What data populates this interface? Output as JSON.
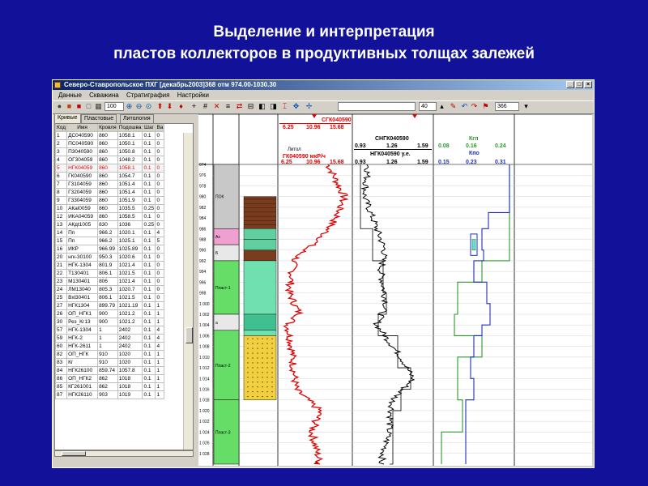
{
  "slide": {
    "title_line1": "Выделение  и интерпретация",
    "title_line2": "пластов коллекторов в продуктивных толщах залежей"
  },
  "window": {
    "title": "Северо-Ставропольское ПХГ [декабрь2003]368  отм  974.00-1030.30",
    "controls": [
      "_",
      "□",
      "×"
    ]
  },
  "menu": [
    "Данные",
    "Скважина",
    "Стратиграфия",
    "Настройки"
  ],
  "toolbar": {
    "zoom_value": "100",
    "field_value": "40",
    "select_value": "366"
  },
  "left_tabs": [
    "Кривые",
    "Пластовые",
    "Литология"
  ],
  "table": {
    "headers": [
      "Код",
      "Имя",
      "Кровля",
      "Подошва",
      "Шаг",
      "Ва"
    ],
    "rows": [
      [
        "1",
        "ДС040590",
        "860",
        "1058.1",
        "0.1",
        "0"
      ],
      [
        "2",
        "ПС040590",
        "860",
        "1050.1",
        "0.1",
        "0"
      ],
      [
        "3",
        "П3040590",
        "860",
        "1050.8",
        "0.1",
        "0"
      ],
      [
        "4",
        "ОГ304059",
        "860",
        "1048.2",
        "0.1",
        "0"
      ],
      [
        "5",
        "НГК04059",
        "860",
        "1058.1",
        "0.1",
        "0"
      ],
      [
        "6",
        "ГК040590",
        "860",
        "1054.7",
        "0.1",
        "0"
      ],
      [
        "7",
        "Г3104059",
        "860",
        "1051.4",
        "0.1",
        "0"
      ],
      [
        "8",
        "Г3204059",
        "860",
        "1051.4",
        "0.1",
        "0"
      ],
      [
        "9",
        "Г3304059",
        "860",
        "1051.9",
        "0.1",
        "0"
      ],
      [
        "10",
        "АКаl0059",
        "860",
        "1035.5",
        "0.25",
        "0"
      ],
      [
        "12",
        "ИКА04059",
        "860",
        "1058.5",
        "0.1",
        "0"
      ],
      [
        "13",
        "АКдt1005",
        "830",
        "1036",
        "0.25",
        "0"
      ],
      [
        "14",
        "Пп",
        "966.2",
        "1020.1",
        "0.1",
        "4"
      ],
      [
        "15",
        "Пп",
        "966.2",
        "1025.1",
        "0.1",
        "5"
      ],
      [
        "16",
        "ИКР",
        "966.99",
        "1025.89",
        "0.1",
        "0"
      ],
      [
        "20",
        "нгк-30100",
        "950.3",
        "1020.6",
        "0.1",
        "0"
      ],
      [
        "21",
        "НГК-1304",
        "801.9",
        "1021.4",
        "0.1",
        "0"
      ],
      [
        "22",
        "Т130401",
        "806.1",
        "1021.5",
        "0.1",
        "0"
      ],
      [
        "23",
        "М130401",
        "806",
        "1021.4",
        "0.1",
        "0"
      ],
      [
        "24",
        "ЛМ13040",
        "805.3",
        "1020.7",
        "0.1",
        "0"
      ],
      [
        "25",
        "Вхl30401",
        "806.1",
        "1021.5",
        "0.1",
        "0"
      ],
      [
        "27",
        "НГК1304",
        "899.79",
        "1021.19",
        "0.1",
        "1"
      ],
      [
        "26",
        "ОП_НГК1",
        "900",
        "1021.2",
        "0.1",
        "1"
      ],
      [
        "30",
        "Рез_Кг13",
        "900",
        "1021.2",
        "0.1",
        "1"
      ],
      [
        "57",
        "НГК-1304",
        "1",
        "2402",
        "0.1",
        "4"
      ],
      [
        "59",
        "НГК-2",
        "1",
        "2402",
        "0.1",
        "4"
      ],
      [
        "60",
        "НГК-2611",
        "1",
        "2402",
        "0.1",
        "4"
      ],
      [
        "82",
        "ОП_НГК",
        "910",
        "1020",
        "0.1",
        "1"
      ],
      [
        "83",
        "Кг",
        "910",
        "1020",
        "0.1",
        "1"
      ],
      [
        "84",
        "НГК26100",
        "859.74",
        "1057.8",
        "0.1",
        "1"
      ],
      [
        "86",
        "ОП_НГК2",
        "862",
        "1018",
        "0.1",
        "1"
      ],
      [
        "85",
        "КГ261001",
        "862",
        "1018",
        "0.1",
        "1"
      ],
      [
        "87",
        "НГК26110",
        "903",
        "1019",
        "0.1",
        "1"
      ]
    ],
    "selected_row": 4
  },
  "plot": {
    "lithology_header": "Литол",
    "gk_header": "ГК040590 мкР/ч",
    "gk_scale": [
      "6.25",
      "10.96",
      "15.68"
    ],
    "sgk_header": "СГК040590",
    "sgk_scale": [
      "6.25",
      "10.96",
      "15.68"
    ],
    "sngk_header": "СНГК040590",
    "sngk_scale": [
      "0.93",
      "1.26",
      "1.59"
    ],
    "ngk_header": "НГК040590 у.е.",
    "ngk_scale": [
      "0.93",
      "1.26",
      "1.59"
    ],
    "kgp_header": "Кгп",
    "kgp_scale": [
      "0.08",
      "0.16",
      "0.24"
    ],
    "kpo_header": "Кпо",
    "kpo_scale": [
      "0.15",
      "0.23",
      "0.31"
    ],
    "depth_labels": [
      "974",
      "976",
      "978",
      "980",
      "982",
      "984",
      "986",
      "988",
      "990",
      "992",
      "994",
      "996",
      "998",
      "1 000",
      "1 002",
      "1 004",
      "1 006",
      "1 008",
      "1 010",
      "1 012",
      "1 014",
      "1 016",
      "1 018",
      "1 020",
      "1 022",
      "1 024",
      "1 026",
      "1 028"
    ],
    "strat_labels": [
      "ПОК",
      "Аз",
      "Б",
      "Пласт-1",
      "а",
      "Пласт-2",
      "Пласт-3"
    ],
    "colors": {
      "red": "#e00000",
      "black": "#000000",
      "green": "#2a9a2a",
      "blue": "#1e2ec0",
      "strat_gray": "#c8c8c8",
      "strat_green": "#66dd66",
      "strat_pink": "#f0a0d0"
    }
  }
}
